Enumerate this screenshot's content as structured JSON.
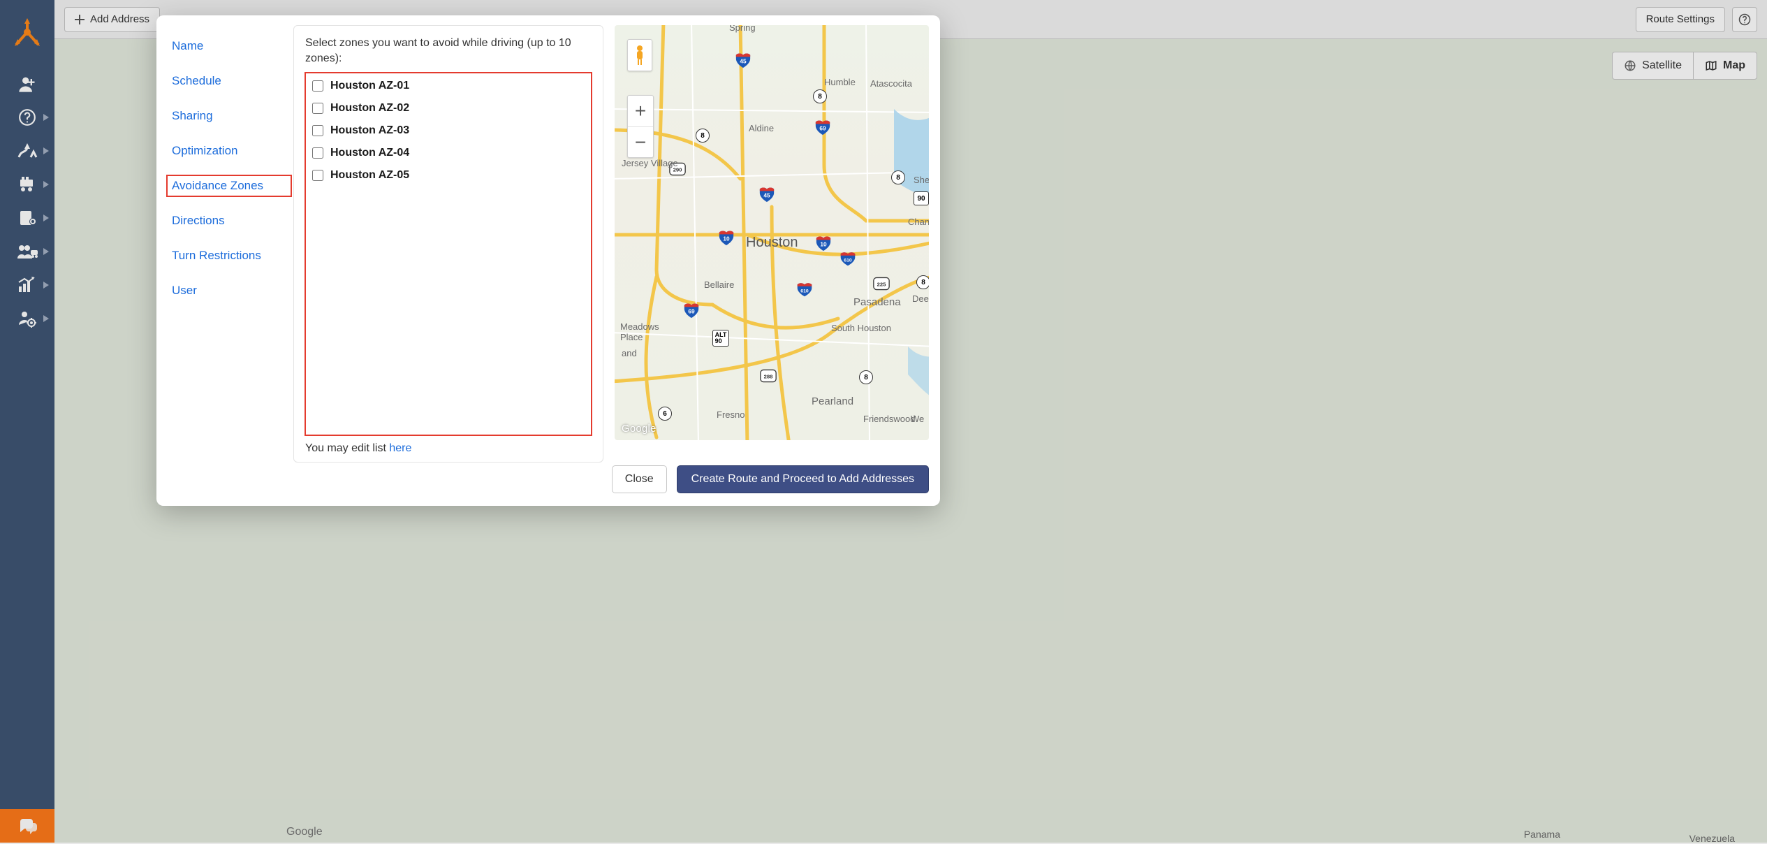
{
  "topbar": {
    "add_address": "Add Address",
    "route_settings": "Route Settings"
  },
  "bg_map": {
    "satellite": "Satellite",
    "map": "Map",
    "google": "Google",
    "panama": "Panama",
    "venezuela": "Venezuela"
  },
  "modal": {
    "side": {
      "name": "Name",
      "schedule": "Schedule",
      "sharing": "Sharing",
      "optimization": "Optimization",
      "avoidance_zones": "Avoidance Zones",
      "directions": "Directions",
      "turn_restrictions": "Turn Restrictions",
      "user": "User"
    },
    "instruction": "Select zones you want to avoid while driving (up to 10 zones):",
    "zones": [
      {
        "label": "Houston AZ-01",
        "checked": false
      },
      {
        "label": "Houston AZ-02",
        "checked": false
      },
      {
        "label": "Houston AZ-03",
        "checked": false
      },
      {
        "label": "Houston AZ-04",
        "checked": false
      },
      {
        "label": "Houston AZ-05",
        "checked": false
      }
    ],
    "edit_prefix": "You may edit list ",
    "edit_link": "here",
    "footer": {
      "close": "Close",
      "create": "Create Route and Proceed to Add Addresses"
    },
    "map": {
      "houston": "Houston",
      "humble": "Humble",
      "atascocita": "Atascocita",
      "aldine": "Aldine",
      "jersey_village": "Jersey Village",
      "bellaire": "Bellaire",
      "meadows_place": "Meadows Place",
      "south_houston": "South Houston",
      "pasadena": "Pasadena",
      "pearland": "Pearland",
      "fresno": "Fresno",
      "friendswood": "Friendswood",
      "channel": "Channel",
      "deer": "Deer",
      "shel": "Shel",
      "and": "and",
      "spring": "Spring",
      "google": "Google"
    }
  }
}
